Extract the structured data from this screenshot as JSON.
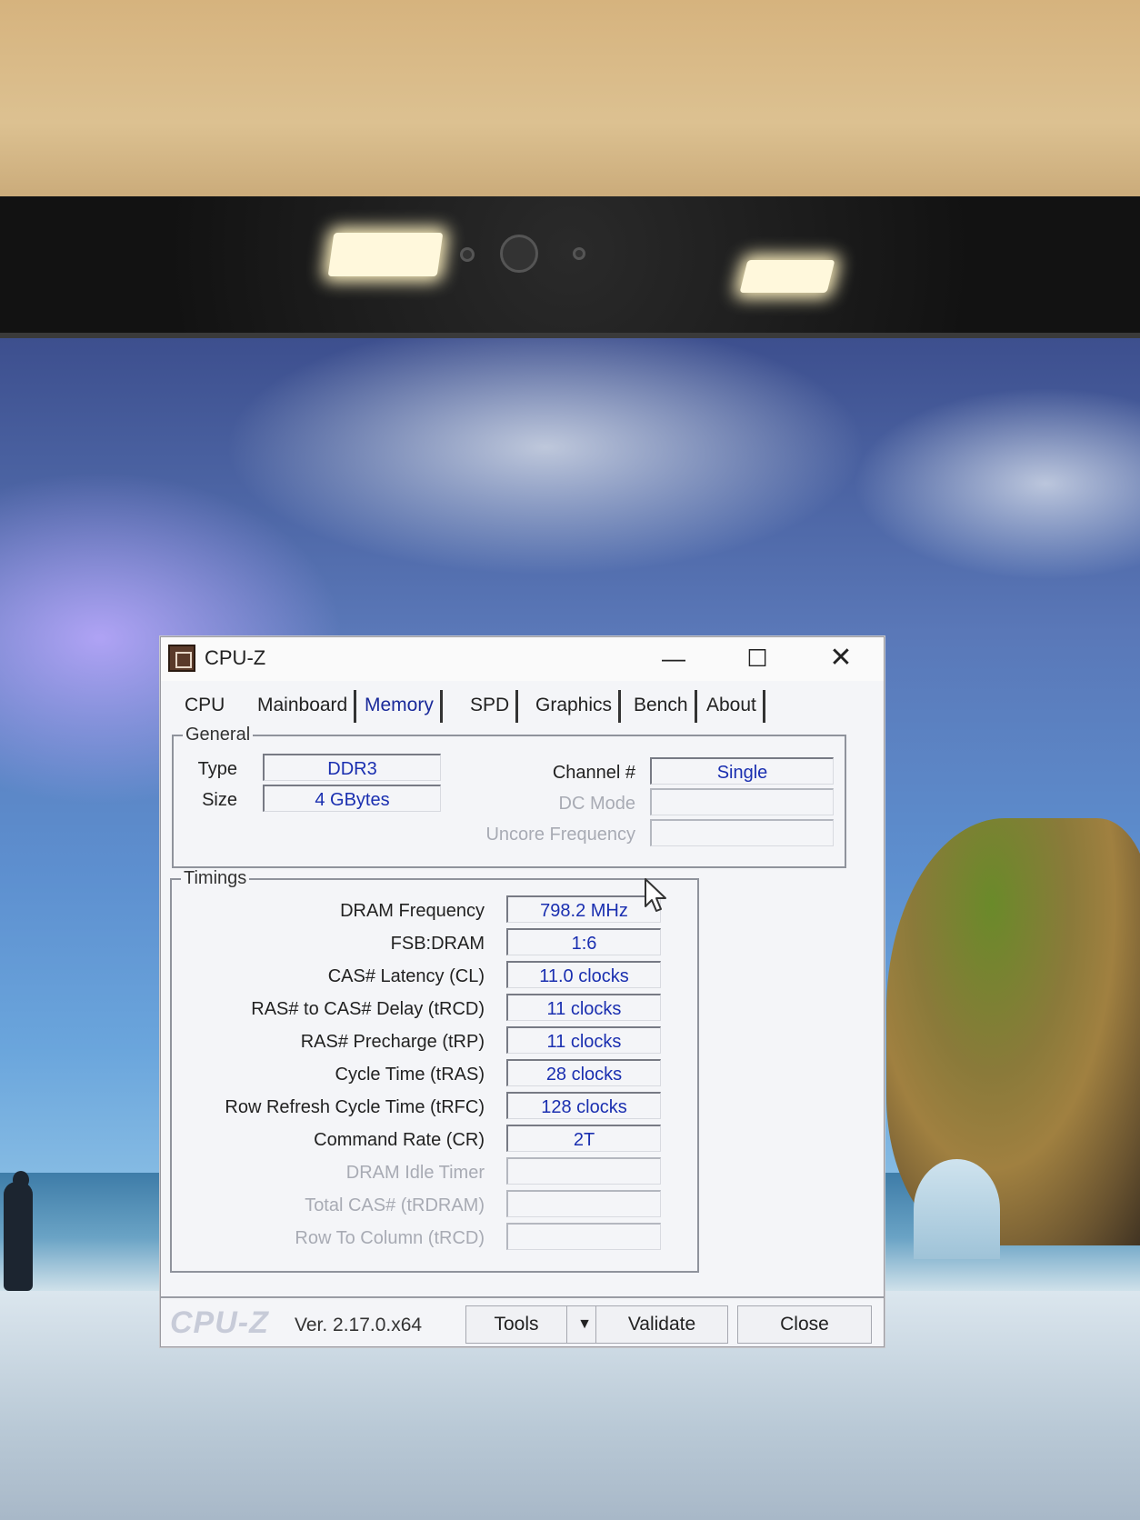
{
  "window": {
    "title": "CPU-Z",
    "minimize_glyph": "—",
    "maximize_glyph": "☐",
    "close_glyph": "✕"
  },
  "tabs": [
    {
      "label": "CPU",
      "active": false
    },
    {
      "label": "Mainboard",
      "active": false
    },
    {
      "label": "Memory",
      "active": true
    },
    {
      "label": "SPD",
      "active": false
    },
    {
      "label": "Graphics",
      "active": false
    },
    {
      "label": "Bench",
      "active": false
    },
    {
      "label": "About",
      "active": false
    }
  ],
  "general": {
    "legend": "General",
    "type": {
      "label": "Type",
      "value": "DDR3"
    },
    "size": {
      "label": "Size",
      "value": "4 GBytes"
    },
    "channel": {
      "label": "Channel #",
      "value": "Single"
    },
    "dc_mode": {
      "label": "DC Mode",
      "value": ""
    },
    "uncore_frequency": {
      "label": "Uncore Frequency",
      "value": ""
    }
  },
  "timings": {
    "legend": "Timings",
    "rows": [
      {
        "label": "DRAM Frequency",
        "value": "798.2 MHz",
        "enabled": true
      },
      {
        "label": "FSB:DRAM",
        "value": "1:6",
        "enabled": true
      },
      {
        "label": "CAS# Latency (CL)",
        "value": "11.0 clocks",
        "enabled": true
      },
      {
        "label": "RAS# to CAS# Delay (tRCD)",
        "value": "11 clocks",
        "enabled": true
      },
      {
        "label": "RAS# Precharge (tRP)",
        "value": "11 clocks",
        "enabled": true
      },
      {
        "label": "Cycle Time (tRAS)",
        "value": "28 clocks",
        "enabled": true
      },
      {
        "label": "Row Refresh Cycle Time (tRFC)",
        "value": "128 clocks",
        "enabled": true
      },
      {
        "label": "Command Rate (CR)",
        "value": "2T",
        "enabled": true
      },
      {
        "label": "DRAM Idle Timer",
        "value": "",
        "enabled": false
      },
      {
        "label": "Total CAS# (tRDRAM)",
        "value": "",
        "enabled": false
      },
      {
        "label": "Row To Column (tRCD)",
        "value": "",
        "enabled": false
      }
    ]
  },
  "footer": {
    "brand": "CPU-Z",
    "version": "Ver. 2.17.0.x64",
    "tools_label": "Tools",
    "tools_arrow": "▼",
    "validate_label": "Validate",
    "close_label": "Close"
  },
  "colors": {
    "value_text": "#1a2fb0",
    "active_tab": "#1a2a9a",
    "disabled_label": "#a8abb4"
  },
  "icons": [
    "cpu-z-app-icon",
    "minimize-icon",
    "maximize-icon",
    "close-icon",
    "chevron-down-icon",
    "mouse-cursor-icon"
  ]
}
